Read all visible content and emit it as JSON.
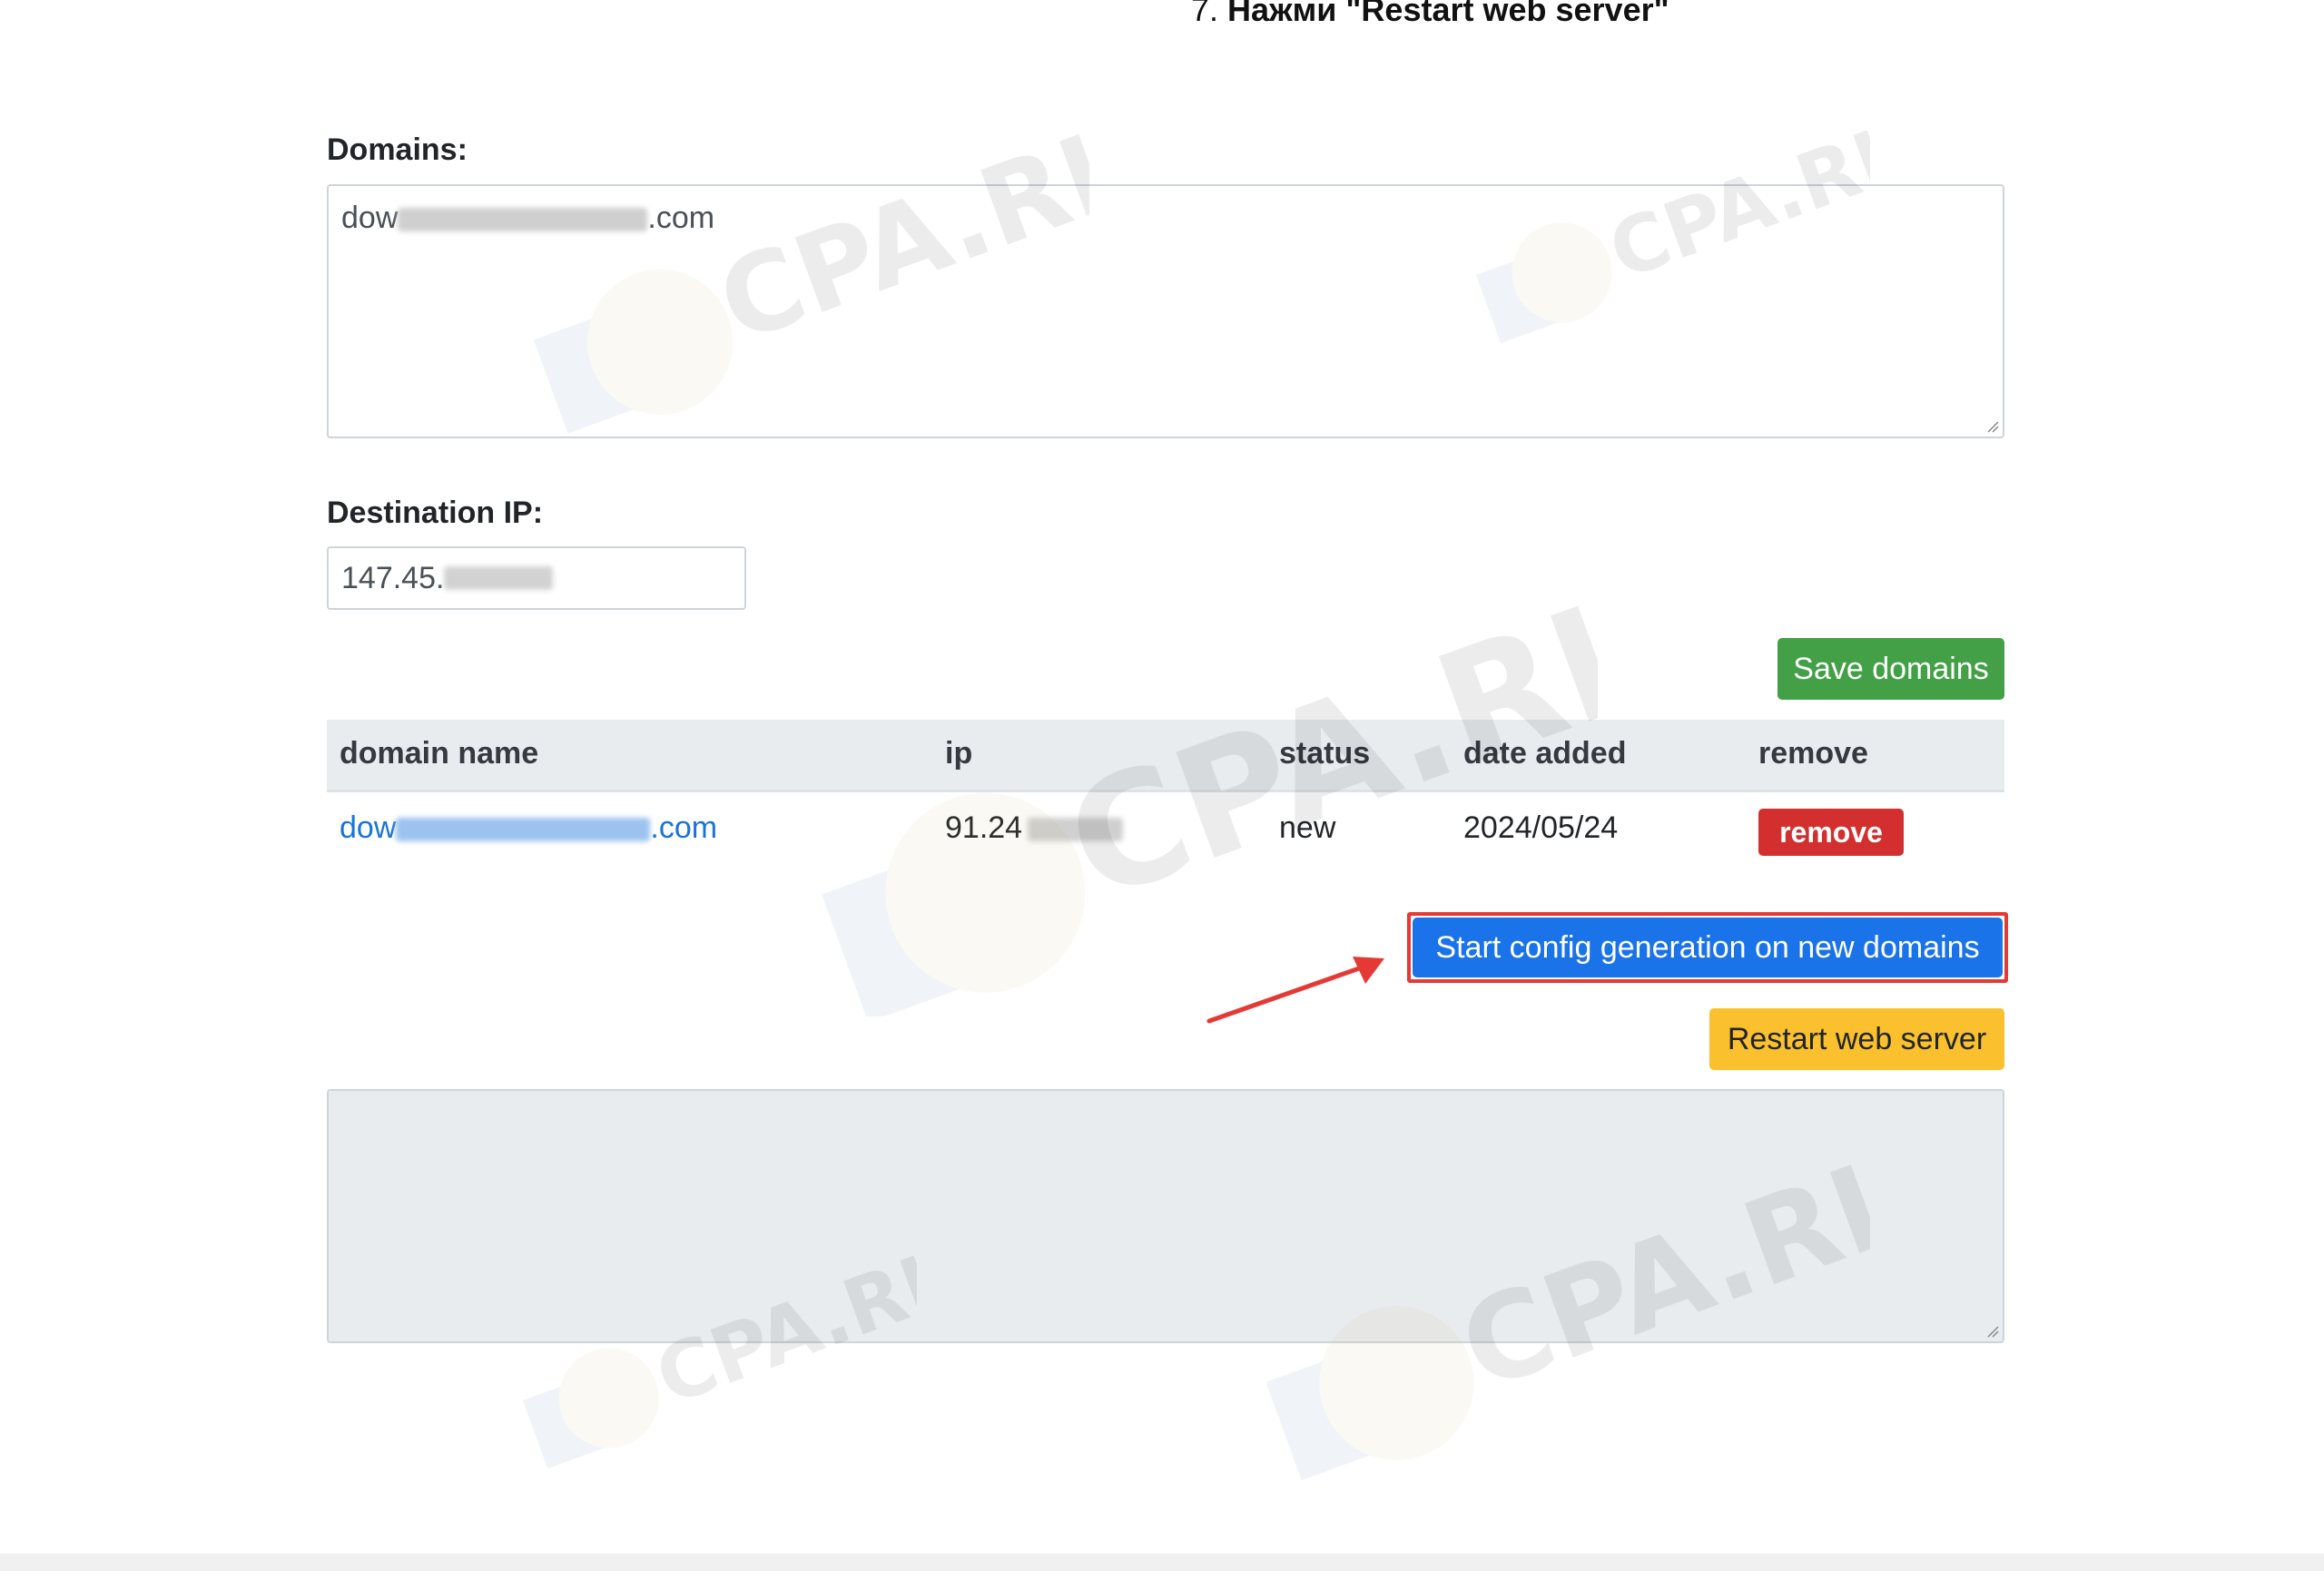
{
  "step": {
    "number": "7.",
    "text": "Нажми \"Restart web server\""
  },
  "domains": {
    "label": "Domains:",
    "value_prefix": "dow",
    "value_suffix": ".com"
  },
  "destination_ip": {
    "label": "Destination IP:",
    "value_prefix": "147.45."
  },
  "buttons": {
    "save": "Save domains",
    "start_config": "Start config generation on new domains",
    "restart": "Restart web server"
  },
  "table": {
    "headers": [
      "domain name",
      "ip",
      "status",
      "date added",
      "remove"
    ],
    "rows": [
      {
        "domain_prefix": "dow",
        "domain_suffix": ".com",
        "ip_prefix": "91.24",
        "status": "new",
        "date_added": "2024/05/24",
        "remove_label": "remove"
      }
    ]
  },
  "watermark": "CPA.RIP",
  "colors": {
    "save_button": "#43a047",
    "start_button": "#1a73e8",
    "highlight_border": "#e53935",
    "restart_button": "#fbc02d",
    "remove_button": "#d32f2f",
    "link": "#1a73d9",
    "arrow": "#e53935"
  }
}
